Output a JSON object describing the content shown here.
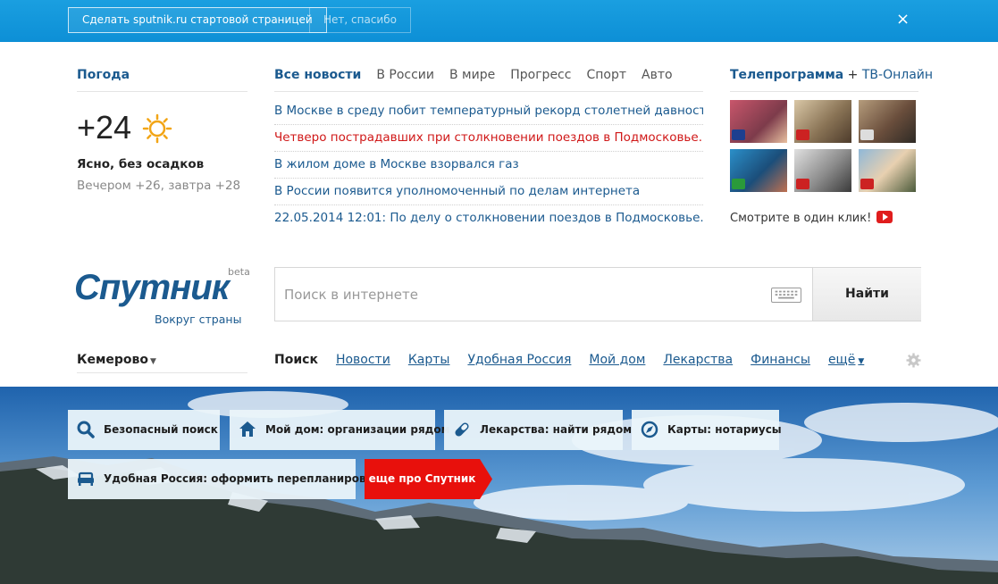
{
  "topbar": {
    "make_start": "Сделать sputnik.ru стартовой страницей",
    "no_thanks": "Нет, спасибо",
    "close": "×"
  },
  "weather": {
    "title": "Погода",
    "temp": "+24",
    "description": "Ясно, без осадков",
    "forecast": "Вечером +26, завтра +28",
    "icon": "sun-icon"
  },
  "news": {
    "tabs": [
      "Все новости",
      "В России",
      "В мире",
      "Прогресс",
      "Спорт",
      "Авто"
    ],
    "items": [
      "В Москве в среду побит температурный рекорд столетней давности",
      "Четверо пострадавших при столкновении поездов в Подмосковье...",
      "В жилом доме в Москве взорвался газ",
      "В России появится уполномоченный по делам интернета",
      "22.05.2014 12:01: По делу о столкновении поездов в Подмосковье..."
    ]
  },
  "tv": {
    "title": "Телепрограмма",
    "plus": " + ",
    "online": "ТВ-Онлайн",
    "watch": "Смотрите в один клик!",
    "colors": [
      "#b7495b",
      "#9a8766",
      "#7a5f4d",
      "#2f6ea0",
      "#8e8e8e",
      "#5f8fb8"
    ]
  },
  "logo": {
    "word": "Спутник",
    "beta": "beta",
    "subtitle": "Вокруг страны"
  },
  "search": {
    "placeholder": "Поиск в интернете",
    "button": "Найти"
  },
  "city": "Кемерово",
  "nav": {
    "active": "Поиск",
    "items": [
      "Новости",
      "Карты",
      "Удобная Россия",
      "Мой дом",
      "Лекарства",
      "Финансы"
    ],
    "more": "ещё"
  },
  "tiles": {
    "safe_search": "Безопасный поиск",
    "my_home": "Мой дом: организации рядом",
    "medicine": "Лекарства: найти рядом",
    "maps": "Карты: нотариусы",
    "convenient": "Удобная Россия: оформить перепланировку",
    "more": "еще про Спутник"
  },
  "colors": {
    "brand": "#1b5a8f",
    "hot_news": "#d01818",
    "accent_red": "#e8100c",
    "topbar": "#1a9fe0"
  }
}
